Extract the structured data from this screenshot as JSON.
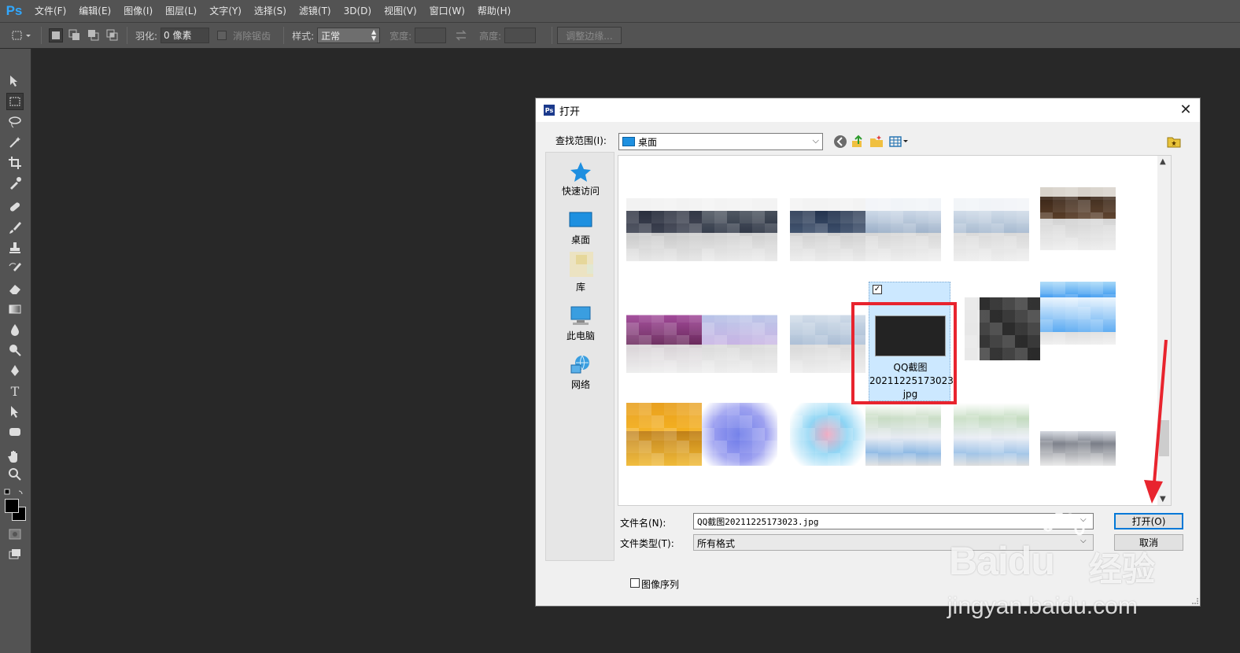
{
  "app": {
    "logo": "Ps"
  },
  "menu": [
    "文件(F)",
    "编辑(E)",
    "图像(I)",
    "图层(L)",
    "文字(Y)",
    "选择(S)",
    "滤镜(T)",
    "3D(D)",
    "视图(V)",
    "窗口(W)",
    "帮助(H)"
  ],
  "options": {
    "feather_label": "羽化:",
    "feather_value": "0 像素",
    "antialias_label": "消除锯齿",
    "style_label": "样式:",
    "style_value": "正常",
    "width_label": "宽度:",
    "height_label": "高度:",
    "refine_edge_label": "调整边缘..."
  },
  "dialog": {
    "title": "打开",
    "look_in_label": "查找范围(I):",
    "look_in_value": "桌面",
    "places": [
      "快速访问",
      "桌面",
      "库",
      "此电脑",
      "网络"
    ],
    "selected_file": {
      "line1": "QQ截图",
      "line2": "20211225173023.",
      "line3": "jpg"
    },
    "filename_label": "文件名(N):",
    "filename_value": "QQ截图20211225173023.jpg",
    "filetype_label": "文件类型(T):",
    "filetype_value": "所有格式",
    "open_button": "打开(O)",
    "cancel_button": "取消",
    "image_sequence_label": "图像序列"
  },
  "watermark": {
    "logo": "Baidu",
    "cn": "经验",
    "url": "jingyan.baidu.com"
  },
  "colors": {
    "highlight": "#e8242e",
    "selection": "#cce8ff",
    "accent": "#0078d7"
  }
}
